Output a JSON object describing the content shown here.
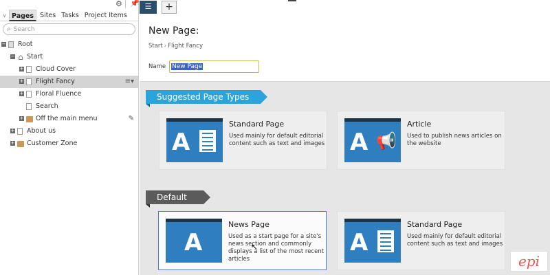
{
  "nav": {
    "tabs": [
      "Pages",
      "Sites",
      "Tasks",
      "Project Items"
    ],
    "search_placeholder": "Search",
    "tree": [
      {
        "label": "Root",
        "indent": 0,
        "icon": "root",
        "expander": "minus"
      },
      {
        "label": "Start",
        "indent": 1,
        "icon": "home",
        "expander": "minus"
      },
      {
        "label": "Cloud Cover",
        "indent": 2,
        "icon": "page",
        "expander": "plus"
      },
      {
        "label": "Flight Fancy",
        "indent": 2,
        "icon": "page",
        "expander": "plus",
        "selected": true,
        "action": "context-menu-icon"
      },
      {
        "label": "Floral Fluence",
        "indent": 2,
        "icon": "page",
        "expander": "plus"
      },
      {
        "label": "Search",
        "indent": 2,
        "icon": "page",
        "expander": "none"
      },
      {
        "label": "Off the main menu",
        "indent": 2,
        "icon": "container",
        "expander": "plus",
        "action": "edit-pencil-icon"
      },
      {
        "label": "About us",
        "indent": 1,
        "icon": "page",
        "expander": "plus"
      },
      {
        "label": "Customer Zone",
        "indent": 1,
        "icon": "container",
        "expander": "plus"
      }
    ]
  },
  "page": {
    "title": "New Page:",
    "breadcrumb": [
      "Start",
      "Flight Fancy"
    ],
    "name_label": "Name",
    "name_value": "New Page"
  },
  "sections": {
    "suggested": "Suggested Page Types",
    "default": "Default"
  },
  "suggested_cards": [
    {
      "title": "Standard Page",
      "desc": "Used mainly for default editorial content such as text and images",
      "icon": "document-icon"
    },
    {
      "title": "Article",
      "desc": "Used to publish news articles on the website",
      "icon": "megaphone-icon"
    }
  ],
  "default_cards": [
    {
      "title": "News Page",
      "desc": "Used as a start page for a site's news section and commonly displays a list of the most recent articles",
      "icon": "none"
    },
    {
      "title": "Standard Page",
      "desc": "Used mainly for default editorial content such as text and images",
      "icon": "document-icon"
    }
  ],
  "logo_text": "epi",
  "colors": {
    "ribbon_blue": "#2ba3dd",
    "ribbon_grey": "#5b5b5b",
    "thumb_blue": "#2f7ec0",
    "selection_border": "#4a77c4"
  }
}
